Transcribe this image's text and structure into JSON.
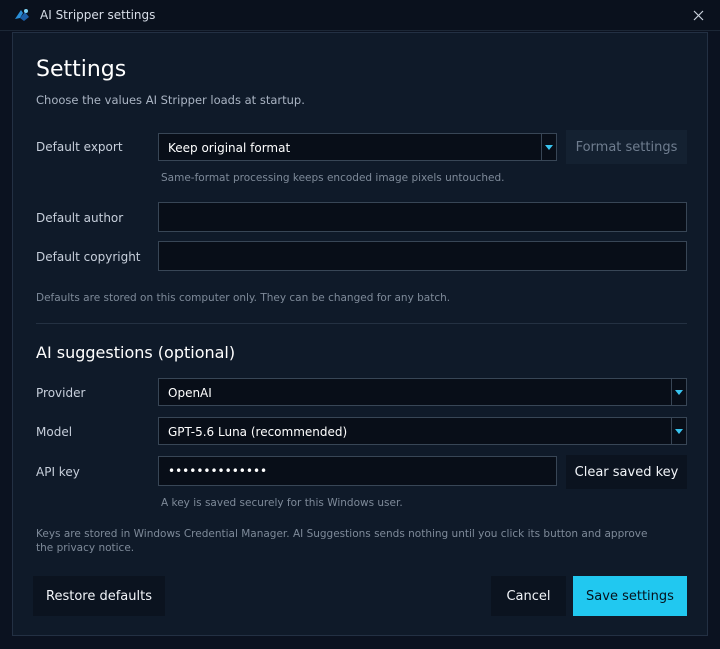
{
  "window": {
    "title": "AI Stripper settings"
  },
  "header": {
    "title": "Settings",
    "subtitle": "Choose the values AI Stripper loads at startup."
  },
  "defaults": {
    "export_label": "Default export",
    "export_value": "Keep original format",
    "format_settings_button": "Format settings",
    "export_hint": "Same-format processing keeps encoded image pixels untouched.",
    "author_label": "Default author",
    "author_value": "",
    "copyright_label": "Default copyright",
    "copyright_value": "",
    "storage_hint": "Defaults are stored on this computer only. They can be changed for any batch."
  },
  "ai": {
    "title": "AI suggestions (optional)",
    "provider_label": "Provider",
    "provider_value": "OpenAI",
    "model_label": "Model",
    "model_value": "GPT-5.6 Luna (recommended)",
    "api_key_label": "API key",
    "api_key_value": "••••••••••••••",
    "clear_key_button": "Clear saved key",
    "key_hint": "A key is saved securely for this Windows user.",
    "note": "Keys are stored in Windows Credential Manager. AI Suggestions sends nothing until you click its button and approve the privacy notice."
  },
  "footer": {
    "restore_button": "Restore defaults",
    "cancel_button": "Cancel",
    "save_button": "Save settings"
  },
  "colors": {
    "accent": "#21c8f0",
    "background": "#0f1a29",
    "input_bg": "#080e18"
  }
}
